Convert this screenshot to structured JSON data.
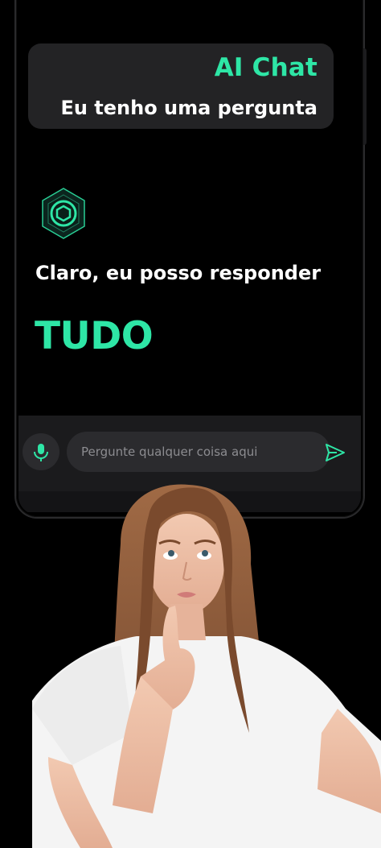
{
  "chat": {
    "user_name": "AI Chat",
    "user_message": "Eu tenho uma pergunta",
    "bot_message": "Claro, eu posso responder",
    "bot_highlight": "TUDO"
  },
  "input": {
    "placeholder": "Pergunte qualquer coisa aqui",
    "mic_icon": "microphone-icon",
    "send_icon": "send-icon"
  },
  "colors": {
    "accent": "#2ee6a6",
    "bubble": "#232325",
    "background": "#000000",
    "input_bg": "#2b2b2e"
  }
}
